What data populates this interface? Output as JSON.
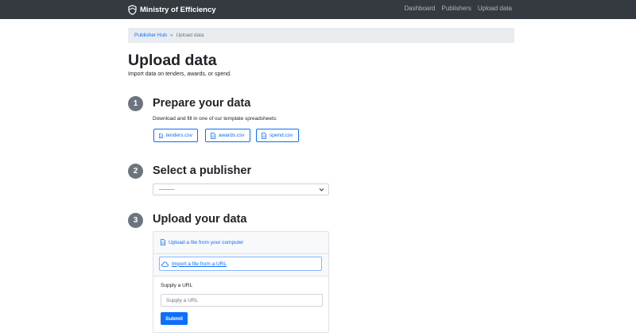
{
  "header": {
    "brand": "Ministry of Efficiency",
    "nav": [
      "Dashboard",
      "Publishers",
      "Upload data"
    ]
  },
  "breadcrumb": {
    "home": "Publisher Hub",
    "separator": "»",
    "current": "Upload data"
  },
  "page": {
    "title": "Upload data",
    "lead": "Import data on tenders, awards, or spend."
  },
  "steps": [
    {
      "number": "1",
      "title": "Prepare your data",
      "help": "Download and fill in one of our template spreadsheets:",
      "files": [
        "tenders.csv",
        "awards.csv",
        "spend.csv"
      ]
    },
    {
      "number": "2",
      "title": "Select a publisher",
      "select_value": "---------"
    },
    {
      "number": "3",
      "title": "Upload your data",
      "tab_file": "Upload a file from your computer",
      "tab_url": "Import a file from a URL",
      "url_label": "Supply a URL",
      "url_placeholder": "Supply a URL",
      "submit": "Submit"
    }
  ],
  "colors": {
    "navbar": "#343a40",
    "primary": "#0d6efd",
    "step_badge": "#6c757d",
    "breadcrumb_bg": "#e9ecef"
  },
  "icons": {
    "brand": "shield-icon",
    "file": "file-icon",
    "cloud": "cloud-icon",
    "select": "chevron-down-icon"
  }
}
